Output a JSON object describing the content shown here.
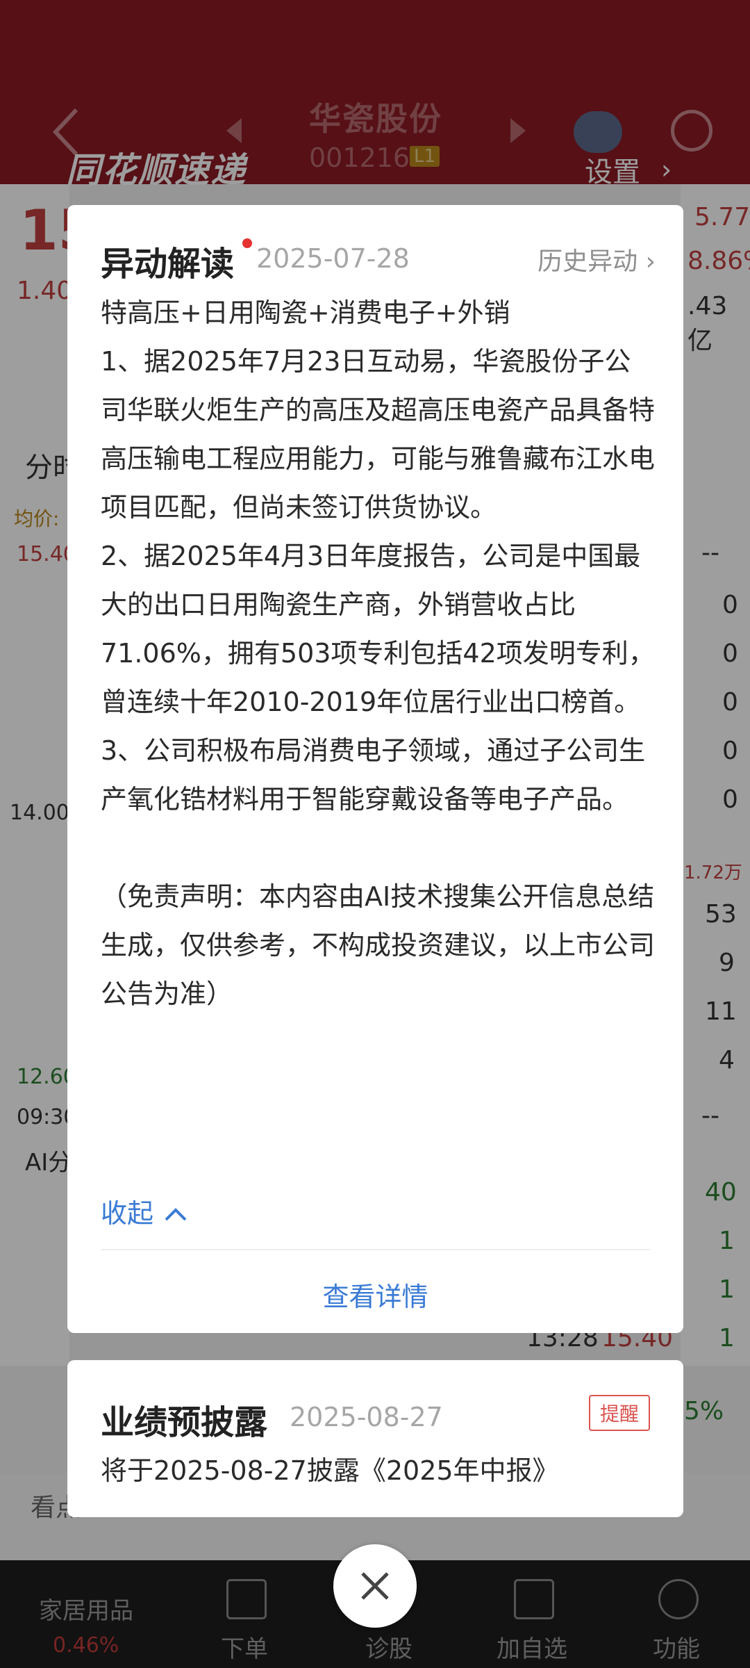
{
  "background": {
    "brand": "同花顺速递",
    "stock_name": "华瓷股份",
    "stock_code": "001216",
    "level": "L1",
    "settings_label": "设置",
    "fragments": {
      "price_partial": "15",
      "change_partial": "1.40",
      "right_1": "5.77",
      "right_2": "8.86%",
      "right_3": ".43亿",
      "tab_partial": "分时",
      "avg_price": "均价:",
      "y_top": "15.40",
      "y_mid": "14.00",
      "y_low": "12.60",
      "time_start": "09:30",
      "ai_partial": "AI分",
      "dashes_1": "--",
      "dashes_2": "--",
      "zeros": [
        "0",
        "0",
        "0",
        "0",
        "0"
      ],
      "vol": "1.72万",
      "nums": [
        "53",
        "9",
        "11",
        "4"
      ],
      "nums2": [
        "40",
        "1",
        "1",
        "1"
      ],
      "tick_time": "13:28",
      "tick_price": "15.40",
      "bottom_tab_left": "看点",
      "pct_right": "5%"
    },
    "nav": [
      {
        "label": "家居用品",
        "sub": "0.46%"
      },
      {
        "label": "下单"
      },
      {
        "label": "诊股"
      },
      {
        "label": "加自选"
      },
      {
        "label": "功能"
      }
    ]
  },
  "dialog": {
    "title": "异动解读",
    "date": "2025-07-28",
    "history_label": "历史异动",
    "headline": "特高压+日用陶瓷+消费电子+外销",
    "point1": "1、据2025年7月23日互动易，华瓷股份子公司华联火炬生产的高压及超高压电瓷产品具备特高压输电工程应用能力，可能与雅鲁藏布江水电项目匹配，但尚未签订供货协议。",
    "point2": "2、据2025年4月3日年度报告，公司是中国最大的出口日用陶瓷生产商，外销营收占比71.06%，拥有503项专利包括42项发明专利，曾连续十年2010-2019年位居行业出口榜首。",
    "point3": "3、公司积极布局消费电子领域，通过子公司生产氧化锆材料用于智能穿戴设备等电子产品。",
    "disclaimer": "（免责声明：本内容由AI技术搜集公开信息总结生成，仅供参考，不构成投资建议，以上市公司公告为准）",
    "collapse_label": "收起",
    "details_label": "查看详情"
  },
  "forecast": {
    "title": "业绩预披露",
    "date": "2025-08-27",
    "remind_label": "提醒",
    "text": "将于2025-08-27披露《2025年中报》"
  },
  "colors": {
    "brand_red": "#8c1b24",
    "link_blue": "#3a7bd5",
    "dot_red": "#e63232"
  }
}
